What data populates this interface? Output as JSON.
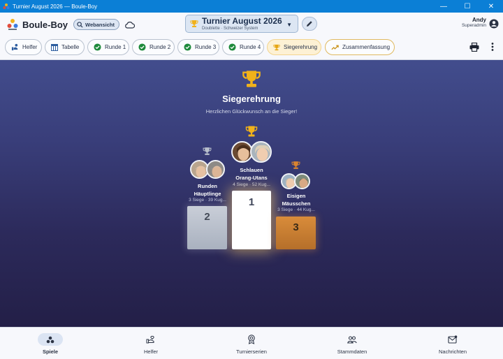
{
  "window": {
    "title": "Turnier August 2026 — Boule-Boy",
    "controls": [
      "minimize-icon",
      "maximize-icon",
      "close-icon"
    ]
  },
  "header": {
    "brand": "Boule-Boy",
    "web_badge": "Webansicht",
    "tournament": {
      "name": "Turnier August 2026",
      "subtitle": "Doublette · Schweizer System"
    },
    "user": {
      "name": "Andy",
      "role": "Superadmin"
    }
  },
  "tabs": [
    {
      "label": "Helfer",
      "icon": "helper-icon"
    },
    {
      "label": "Tabelle",
      "icon": "table-icon"
    },
    {
      "label": "Runde 1",
      "icon": "check-circle-icon"
    },
    {
      "label": "Runde 2",
      "icon": "check-circle-icon"
    },
    {
      "label": "Runde 3",
      "icon": "check-circle-icon"
    },
    {
      "label": "Runde 4",
      "icon": "check-circle-icon"
    },
    {
      "label": "Siegerehrung",
      "icon": "trophy-icon",
      "active": true
    },
    {
      "label": "Zusammenfassung",
      "icon": "trend-icon"
    }
  ],
  "ceremony": {
    "title": "Siegerehrung",
    "subtitle": "Herzlichen Glückwunsch an die Sieger!",
    "podium": [
      {
        "place": "1",
        "name_line1": "Schlauen",
        "name_line2": "Orang-Utans",
        "stats": "4 Siege · 52 Kug...",
        "trophy_color": "#f1b21a"
      },
      {
        "place": "2",
        "name_line1": "Runden",
        "name_line2": "Häuptlinge",
        "stats": "3 Siege · 39 Kug...",
        "trophy_color": "#b8bfcc"
      },
      {
        "place": "3",
        "name_line1": "Eisigen",
        "name_line2": "Mäusschen",
        "stats": "3 Siege · 44 Kug...",
        "trophy_color": "#d8832f"
      }
    ]
  },
  "bottom_nav": [
    {
      "label": "Spiele",
      "icon": "games-icon",
      "active": true
    },
    {
      "label": "Helfer",
      "icon": "helper-icon"
    },
    {
      "label": "Turnierserien",
      "icon": "series-icon"
    },
    {
      "label": "Stammdaten",
      "icon": "people-icon"
    },
    {
      "label": "Nachrichten",
      "icon": "message-icon"
    }
  ],
  "colors": {
    "title_bar": "#0b7fd6",
    "accent_gold": "#f1b21a",
    "check_green": "#1e8a3b",
    "podium_background": "#2c2a5b"
  }
}
